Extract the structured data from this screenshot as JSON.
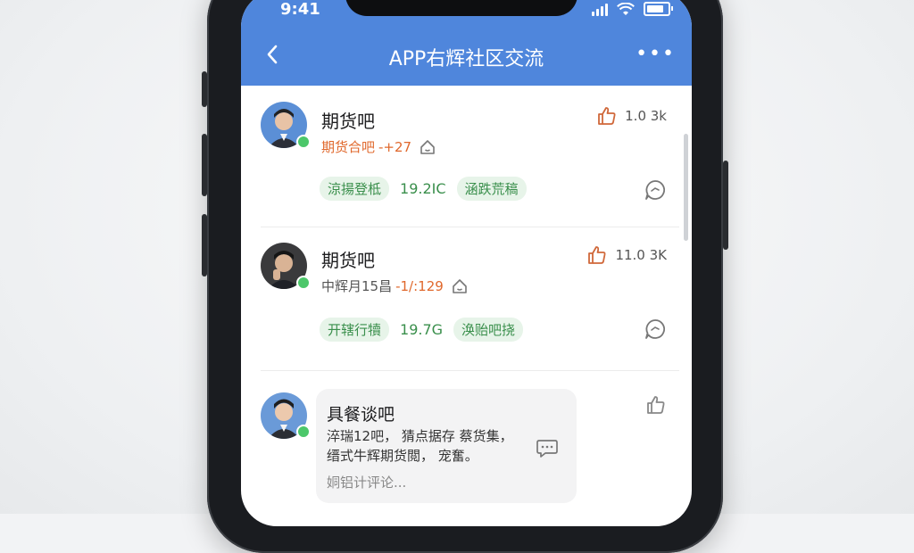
{
  "status_bar": {
    "time": "9:41"
  },
  "header": {
    "title": "APP右辉社区交流",
    "more": "•••"
  },
  "posts": [
    {
      "name": "期货吧",
      "meta_text": "期货合吧",
      "meta_highlight": "-+27",
      "likes": "1.0 3k",
      "tag1": "涼揚登柢",
      "tag_value": "19.2IC",
      "tag2": "涵跌荒稿"
    },
    {
      "name": "期货吧",
      "meta_text": "中辉月15昌",
      "meta_highlight": "-1/:129",
      "likes": "11.0 3K",
      "tag1": "开辖行犢",
      "tag_value": "19.7G",
      "tag2": "涣贻吧挠"
    }
  ],
  "comment": {
    "title": "具餐谈吧",
    "text_line1": "淬瑞12吧，  猜点据存  蔡货集，",
    "text_line2": "缙式牛辉期货閲，  宠奮。",
    "input_placeholder": "姛铝计评论..."
  },
  "colors": {
    "header_blue": "#4f86dc",
    "accent_orange": "#e0682c",
    "tag_green": "#3a8f4c",
    "tag_bg": "#e7f4e9",
    "online_green": "#4cc76a"
  }
}
